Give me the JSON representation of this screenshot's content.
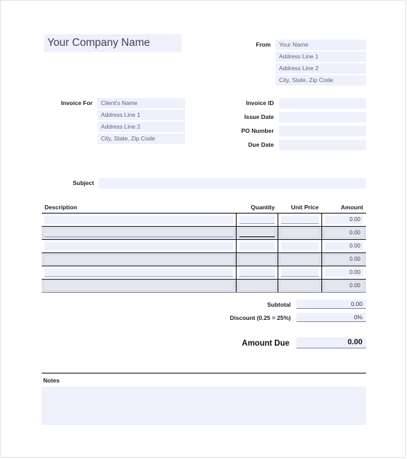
{
  "header": {
    "company_name": "Your Company Name"
  },
  "from": {
    "label": "From",
    "lines": [
      "Your Name",
      "Address Line 1",
      "Address Line 2",
      "City, State, Zip Code"
    ]
  },
  "invoice_for": {
    "label": "Invoice For",
    "lines": [
      "Client's Name",
      "Address Line 1",
      "Address Line 2",
      "City, State, Zip Code"
    ]
  },
  "meta": {
    "fields": [
      {
        "label": "Invoice ID",
        "value": ""
      },
      {
        "label": "Issue Date",
        "value": ""
      },
      {
        "label": "PO Number",
        "value": ""
      },
      {
        "label": "Due Date",
        "value": ""
      }
    ]
  },
  "subject": {
    "label": "Subject",
    "value": ""
  },
  "items": {
    "columns": {
      "description": "Description",
      "quantity": "Quantity",
      "unit_price": "Unit Price",
      "amount": "Amount"
    },
    "rows": [
      {
        "description": "",
        "quantity": "",
        "unit_price": "",
        "amount": "0.00"
      },
      {
        "description": "",
        "quantity": "",
        "unit_price": "",
        "amount": "0.00"
      },
      {
        "description": "",
        "quantity": "",
        "unit_price": "",
        "amount": "0.00"
      },
      {
        "description": "",
        "quantity": "",
        "unit_price": "",
        "amount": "0.00"
      },
      {
        "description": "",
        "quantity": "",
        "unit_price": "",
        "amount": "0.00"
      },
      {
        "description": "",
        "quantity": "",
        "unit_price": "",
        "amount": "0.00"
      }
    ]
  },
  "totals": {
    "subtotal_label": "Subtotal",
    "subtotal_value": "0.00",
    "discount_label": "Discount (0.25 = 25%)",
    "discount_value": "0%",
    "amount_due_label": "Amount Due",
    "amount_due_value": "0.00"
  },
  "notes": {
    "label": "Notes",
    "value": ""
  },
  "colors": {
    "field_bg": "#eef1fb",
    "field_bg_alt": "#e4e7f0",
    "row_alt": "#dcdfea",
    "placeholder_text": "#5a6480",
    "label_text": "#1b1b27",
    "rule": "#000000"
  }
}
